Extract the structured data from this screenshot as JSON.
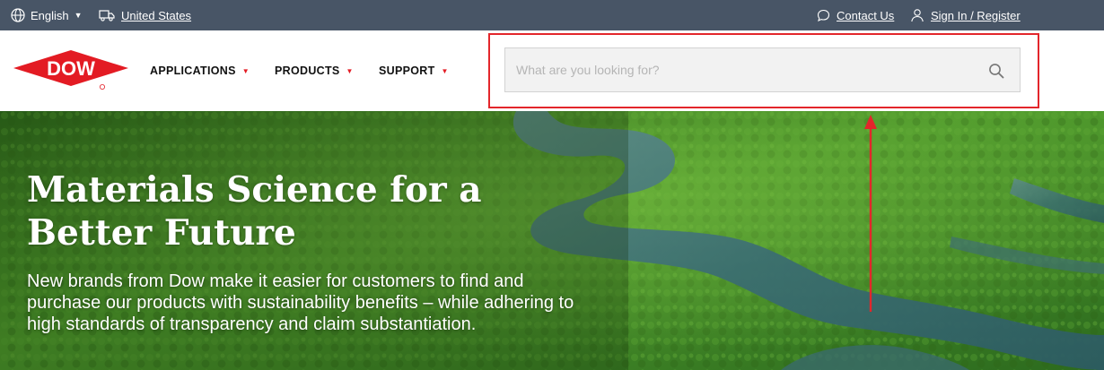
{
  "topbar": {
    "language": "English",
    "country": "United States",
    "contact": "Contact Us",
    "signin": "Sign In / Register"
  },
  "brand": {
    "logo_text": "DOW"
  },
  "nav": {
    "items": [
      {
        "label": "APPLICATIONS"
      },
      {
        "label": "PRODUCTS"
      },
      {
        "label": "SUPPORT"
      }
    ]
  },
  "search": {
    "placeholder": "What are you looking for?",
    "value": ""
  },
  "hero": {
    "title_line1": "Materials Science for a",
    "title_line2": "Better Future",
    "body": "New brands from Dow make it easier for customers to find and purchase our products with sustainability benefits – while adhering to high standards of transparency and claim substantiation."
  },
  "colors": {
    "topbar_bg": "#485566",
    "brand_red": "#e31b23",
    "highlight_red": "#e3262b"
  }
}
